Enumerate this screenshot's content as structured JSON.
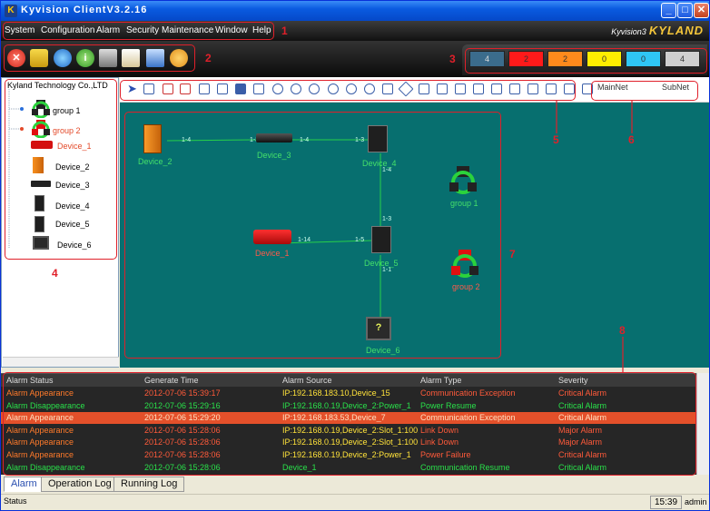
{
  "window": {
    "title": "Kyvision ClientV3.2.16"
  },
  "menu": [
    "System",
    "Configuration",
    "Alarm",
    "Security",
    "Maintenance",
    "Window",
    "Help"
  ],
  "brand": {
    "small": "Kyvision3",
    "logo": "KYLAND"
  },
  "annotations": [
    "1",
    "2",
    "3",
    "4",
    "5",
    "6",
    "7",
    "8"
  ],
  "severity_counts": [
    {
      "count": "4",
      "color": "#3b6c8c"
    },
    {
      "count": "2",
      "color": "#ff1a1a"
    },
    {
      "count": "2",
      "color": "#ff8a1c"
    },
    {
      "count": "0",
      "color": "#ffee00"
    },
    {
      "count": "0",
      "color": "#2fc6f5"
    },
    {
      "count": "4",
      "color": "#cfcfcf"
    }
  ],
  "tree": {
    "root": "Kyland Technology Co.,LTD",
    "items": [
      {
        "label": "group 1",
        "icon": "group-icon"
      },
      {
        "label": "group 2",
        "icon": "group-icon"
      },
      {
        "label": "Device_1",
        "icon": "router-icon"
      },
      {
        "label": "Device_2",
        "icon": "switch-icon"
      },
      {
        "label": "Device_3",
        "icon": "hub-icon"
      },
      {
        "label": "Device_4",
        "icon": "switch-icon"
      },
      {
        "label": "Device_5",
        "icon": "switch-icon"
      },
      {
        "label": "Device_6",
        "icon": "unknown-device-icon"
      }
    ]
  },
  "net_tabs": [
    "MainNet",
    "SubNet"
  ],
  "topology": {
    "devices": [
      "Device_2",
      "Device_3",
      "Device_4",
      "group 1",
      "Device_1",
      "Device_5",
      "group 2",
      "Device_6"
    ],
    "ports": [
      "1-4",
      "1-3",
      "1-4",
      "1-3",
      "1-4",
      "1-3",
      "1-14",
      "1-5",
      "1-1"
    ]
  },
  "alarm_table": {
    "columns": [
      "Alarm Status",
      "Generate Time",
      "Alarm Source",
      "Alarm Type",
      "Severity"
    ],
    "rows": [
      [
        "Alarm Appearance",
        "2012-07-06 15:39:17",
        "IP:192.168.183.10,Device_15",
        "Communication Exception",
        "Critical Alarm"
      ],
      [
        "Alarm Disappearance",
        "2012-07-06 15:29:16",
        "IP:192.168.0.19,Device_2:Power_1",
        "Power Resume",
        "Critical Alarm"
      ],
      [
        "Alarm Appearance",
        "2012-07-06 15:29:20",
        "IP:192.168.183.53,Device_7",
        "Communication Exception",
        "Critical Alarm"
      ],
      [
        "Alarm Appearance",
        "2012-07-06 15:28:06",
        "IP:192.168.0.19,Device_2:Slot_1:100...",
        "Link Down",
        "Major Alarm"
      ],
      [
        "Alarm Appearance",
        "2012-07-06 15:28:06",
        "IP:192.168.0.19,Device_2:Slot_1:100...",
        "Link Down",
        "Major Alarm"
      ],
      [
        "Alarm Appearance",
        "2012-07-06 15:28:06",
        "IP:192.168.0.19,Device_2:Power_1",
        "Power Failure",
        "Critical Alarm"
      ],
      [
        "Alarm Disappearance",
        "2012-07-06 15:28:06",
        "Device_1",
        "Communication Resume",
        "Critical Alarm"
      ]
    ]
  },
  "bottom_tabs": [
    "Alarm",
    "Operation Log",
    "Running Log"
  ],
  "status": {
    "label": "Status",
    "clock": "15:39",
    "user": "admin"
  }
}
